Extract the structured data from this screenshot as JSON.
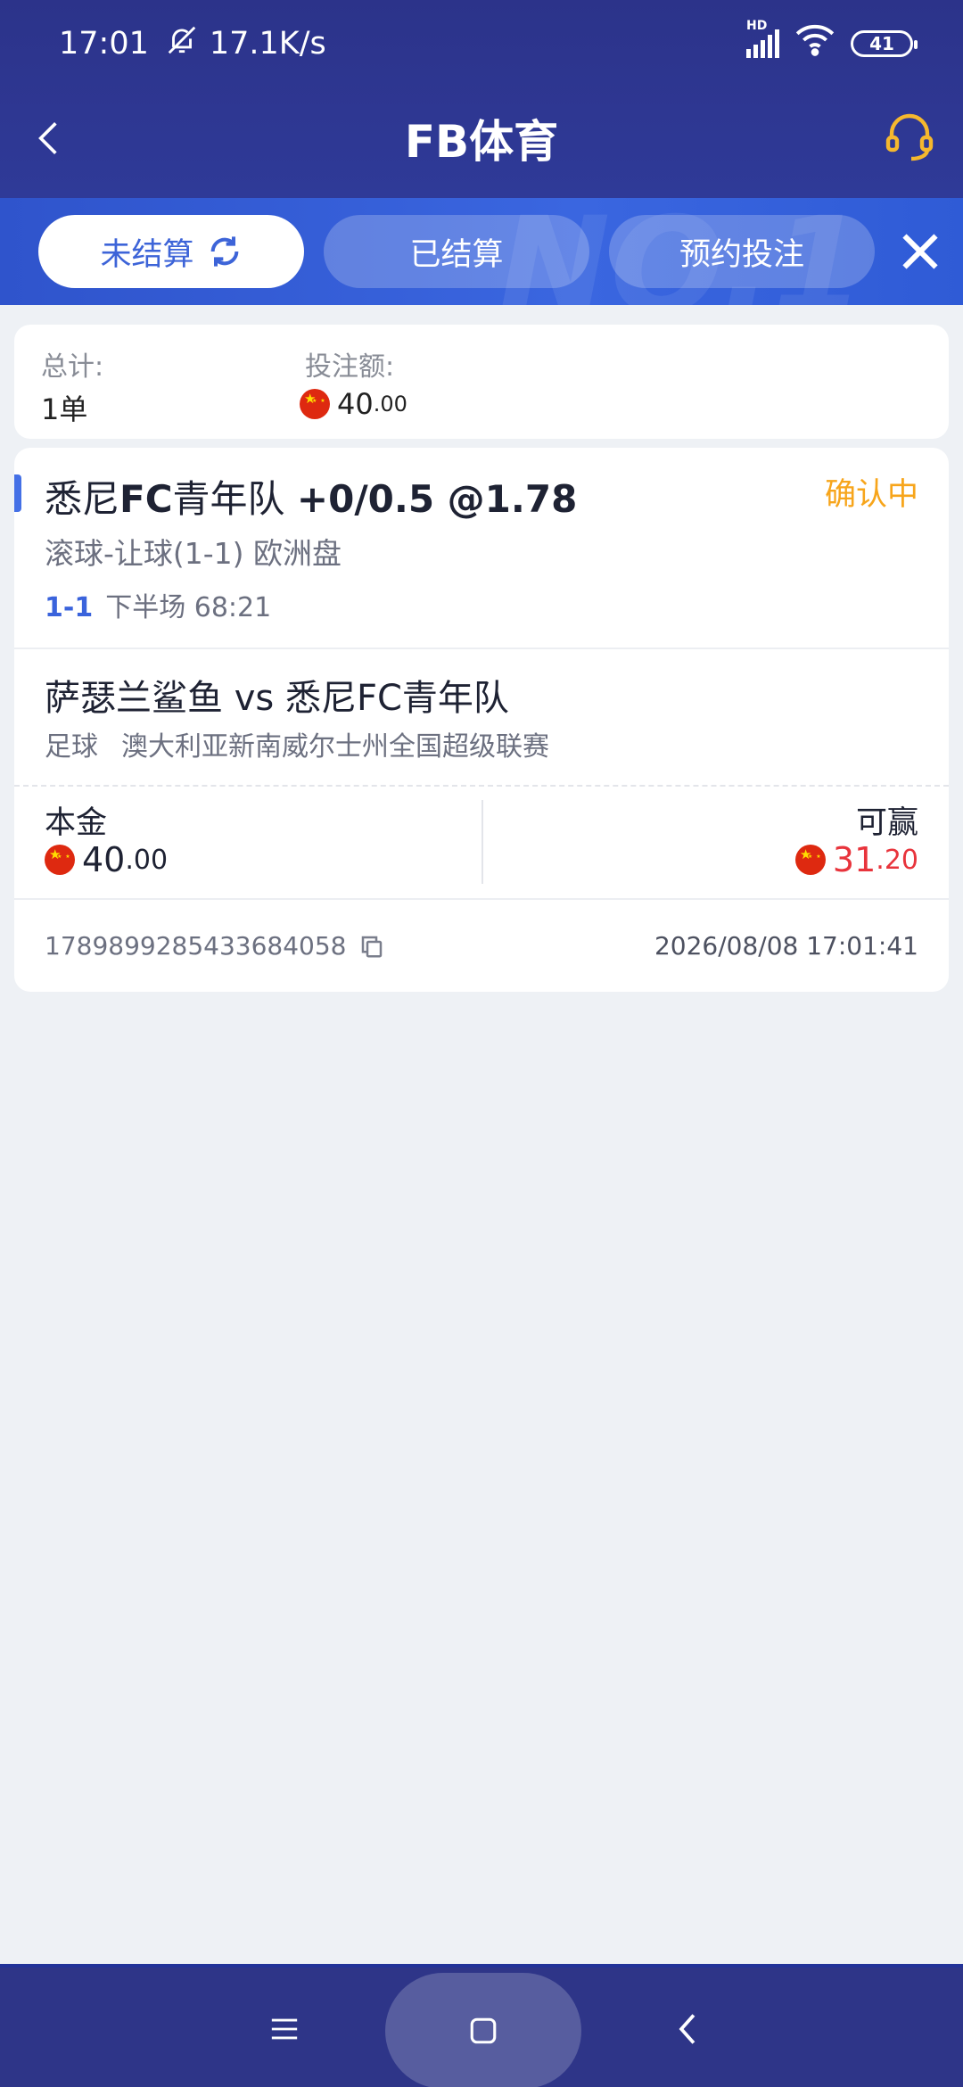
{
  "status_bar": {
    "time": "17:01",
    "net_speed": "17.1K/s",
    "network": "HD",
    "battery": "41"
  },
  "header": {
    "title": "FB体育"
  },
  "tabs": [
    {
      "label": "未结算",
      "active": true
    },
    {
      "label": "已结算",
      "active": false
    },
    {
      "label": "预约投注",
      "active": false
    }
  ],
  "summary": {
    "total_label": "总计:",
    "total_value": "1单",
    "amount_label": "投注额:",
    "amount_int": "40",
    "amount_dec": ".00"
  },
  "bet": {
    "team": "悉尼",
    "team_bold": "FC",
    "team_rest": "青年队",
    "line": "+0/0.5 @1.78",
    "status": "确认中",
    "market": "滚球-让球(1-1) 欧洲盘",
    "score": "1-1",
    "period": "下半场 68:21",
    "match": "萨瑟兰鲨鱼 vs 悉尼FC青年队",
    "sport": "足球",
    "league": "澳大利亚新南威尔士州全国超级联赛",
    "stake_label": "本金",
    "stake_int": "40",
    "stake_dec": ".00",
    "win_label": "可赢",
    "win_int": "31",
    "win_dec": ".20",
    "bet_id": "1789899285433684058",
    "bet_time": "2026/08/08 17:01:41"
  },
  "colors": {
    "header": "#2c338a",
    "tab_band": "#3a66e0",
    "accent_blue": "#3a63dc",
    "pending": "#f7a51b",
    "win_red": "#e8343c"
  },
  "icons": [
    "bell-mute-icon",
    "signal-icon",
    "wifi-icon",
    "back-icon",
    "support-headset-icon",
    "refresh-icon",
    "close-icon",
    "cny-flag-icon",
    "copy-icon",
    "menu-icon",
    "home-icon"
  ]
}
